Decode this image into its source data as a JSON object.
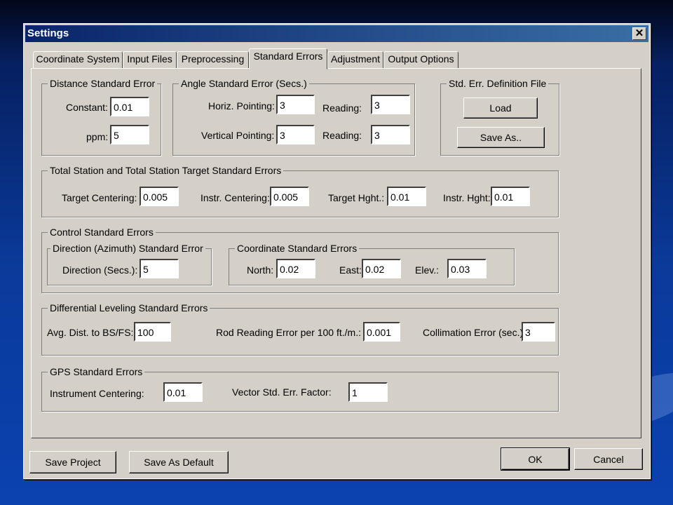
{
  "window": {
    "title": "Settings",
    "close_glyph": "✕"
  },
  "tabs": [
    {
      "label": "Coordinate System"
    },
    {
      "label": "Input Files"
    },
    {
      "label": "Preprocessing"
    },
    {
      "label": "Standard Errors"
    },
    {
      "label": "Adjustment"
    },
    {
      "label": "Output Options"
    }
  ],
  "active_tab": "Standard Errors",
  "distance": {
    "title": "Distance Standard Error",
    "constant_label": "Constant:",
    "constant": "0.01",
    "ppm_label": "ppm:",
    "ppm": "5"
  },
  "angle": {
    "title": "Angle Standard Error (Secs.)",
    "horiz_label": "Horiz. Pointing:",
    "horiz": "3",
    "reading1_label": "Reading:",
    "reading1": "3",
    "vert_label": "Vertical Pointing:",
    "vert": "3",
    "reading2_label": "Reading:",
    "reading2": "3"
  },
  "defn": {
    "title": "Std. Err. Definition File",
    "load": "Load",
    "save_as": "Save As.."
  },
  "total_station": {
    "title": "Total Station and Total Station Target Standard Errors",
    "target_centering_label": "Target Centering:",
    "target_centering": "0.005",
    "instr_centering_label": "Instr. Centering:",
    "instr_centering": "0.005",
    "target_hght_label": "Target Hght.:",
    "target_hght": "0.01",
    "instr_hght_label": "Instr. Hght:",
    "instr_hght": "0.01"
  },
  "control": {
    "title": "Control Standard Errors",
    "direction_group": "Direction (Azimuth) Standard Error",
    "direction_label": "Direction (Secs.):",
    "direction": "5",
    "coord_group": "Coordinate Standard Errors",
    "north_label": "North:",
    "north": "0.02",
    "east_label": "East:",
    "east": "0.02",
    "elev_label": "Elev.:",
    "elev": "0.03"
  },
  "leveling": {
    "title": "Differential Leveling Standard Errors",
    "avg_dist_label": "Avg. Dist. to BS/FS:",
    "avg_dist": "100",
    "rod_label": "Rod Reading Error per 100 ft./m.:",
    "rod": "0.001",
    "collim_label": "Collimation Error (sec.):",
    "collim": "3"
  },
  "gps": {
    "title": "GPS Standard Errors",
    "instr_centering_label": "Instrument Centering:",
    "instr_centering": "0.01",
    "vector_label": "Vector Std. Err. Factor:",
    "vector": "1"
  },
  "footer": {
    "save_project": "Save Project",
    "save_default": "Save As Default",
    "ok": "OK",
    "cancel": "Cancel"
  }
}
